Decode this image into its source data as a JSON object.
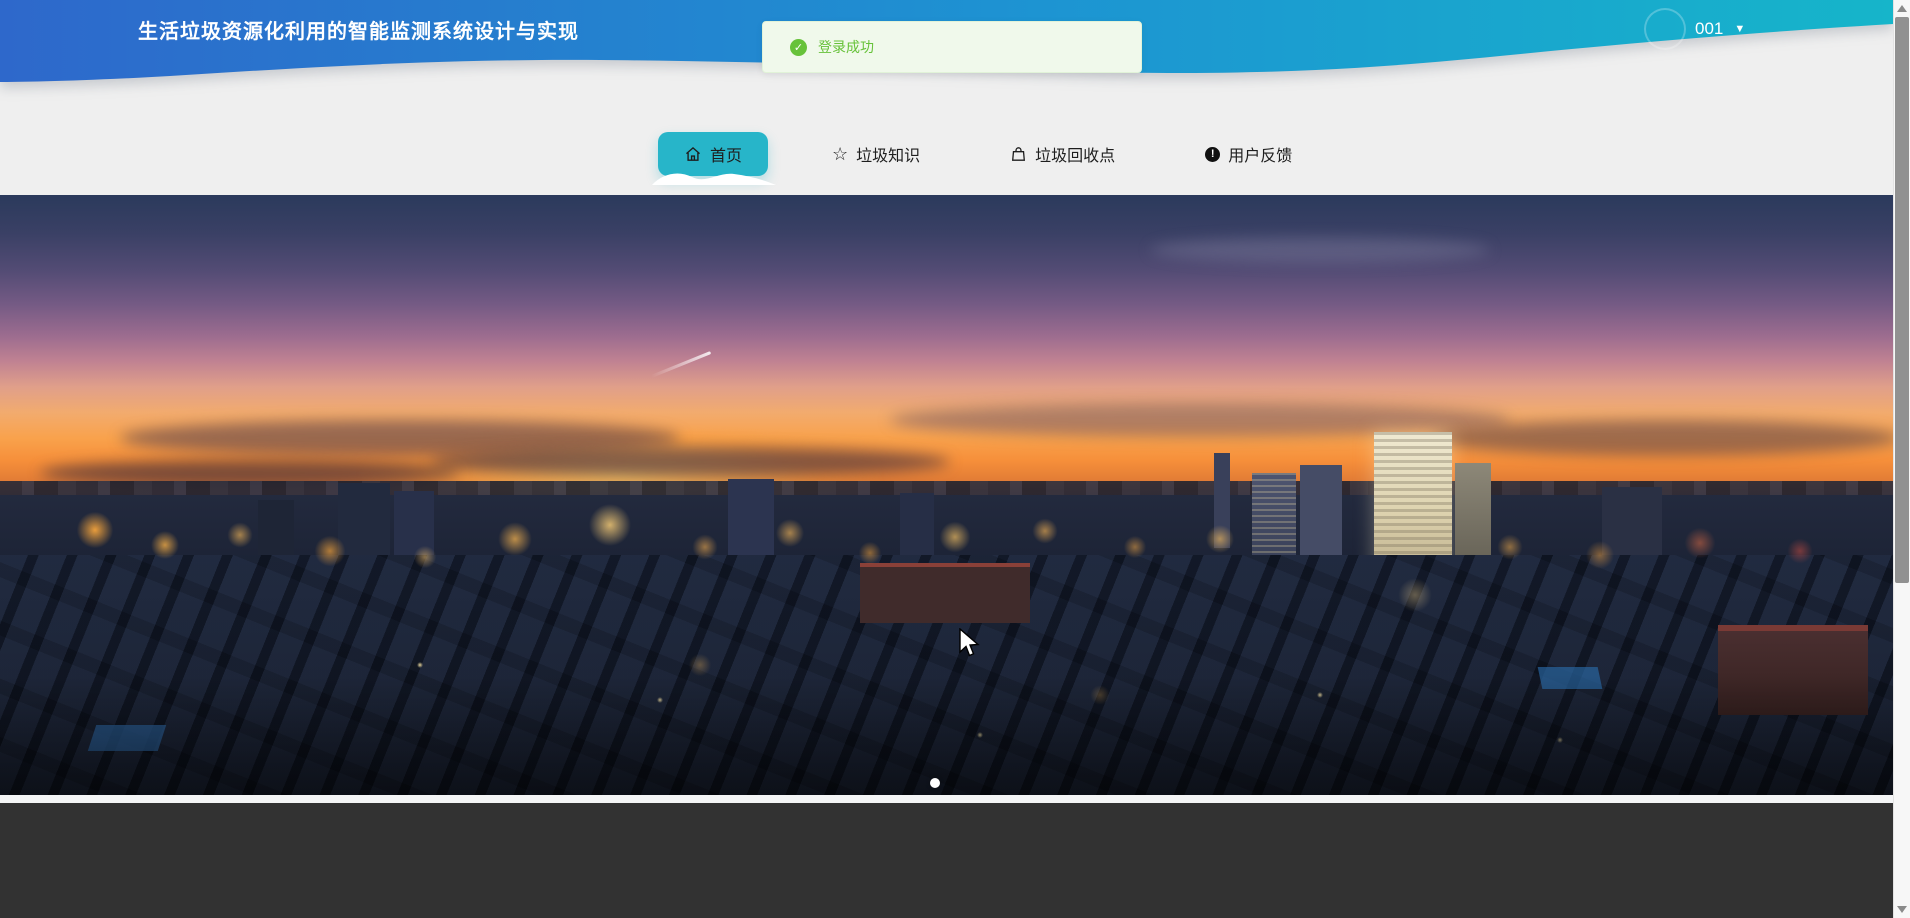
{
  "app": {
    "title": "生活垃圾资源化利用的智能监测系统设计与实现"
  },
  "header": {
    "username": "001",
    "caret_glyph": "▼"
  },
  "toast": {
    "message": "登录成功",
    "icon_glyph": "✓"
  },
  "nav": {
    "tabs": [
      {
        "label": "首页",
        "icon": "home-icon",
        "active": true
      },
      {
        "label": "垃圾知识",
        "icon": "star-icon",
        "glyph": "☆",
        "active": false
      },
      {
        "label": "垃圾回收点",
        "icon": "bag-icon",
        "active": false
      },
      {
        "label": "用户反馈",
        "icon": "alert-icon",
        "glyph": "!",
        "active": false
      }
    ]
  },
  "carousel": {
    "dot_count": 1,
    "active_dot": 1,
    "slide_description": "city skyline at dusk"
  },
  "colors": {
    "header_gradient_left": "#2e68cb",
    "header_gradient_right": "#16b5ca",
    "active_tab": "#27b5c9",
    "toast_bg": "#f0f9eb",
    "toast_text": "#67c23a",
    "page_bg": "#efefef",
    "footer_bg": "#323232"
  }
}
